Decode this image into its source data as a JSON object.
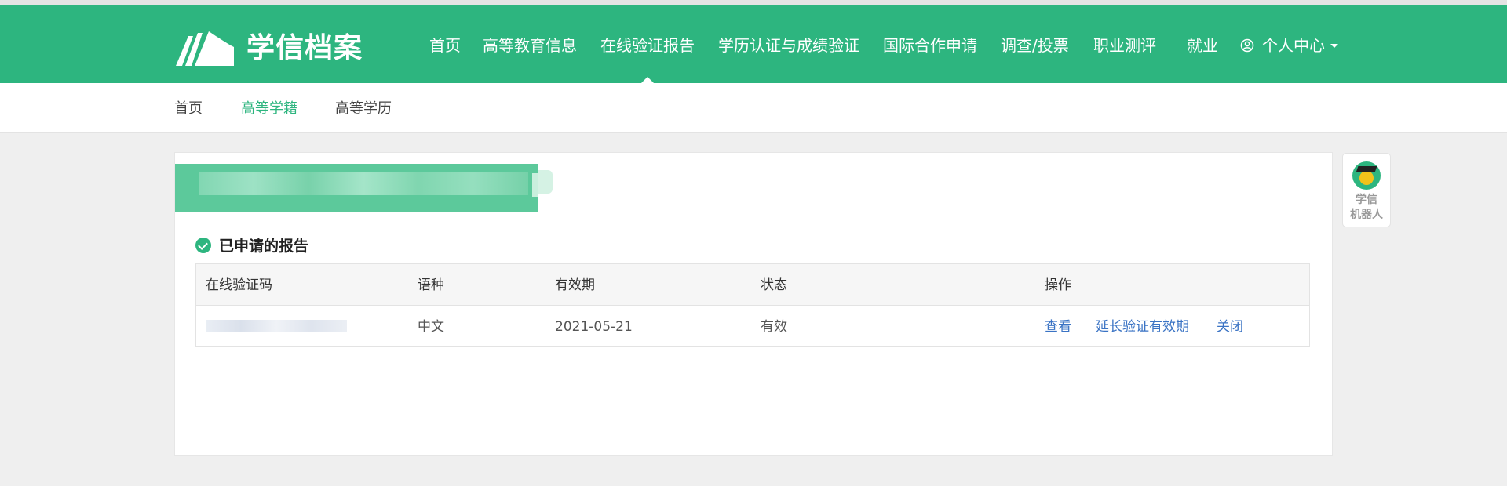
{
  "header": {
    "logo_text": "学信档案",
    "nav": [
      "首页",
      "高等教育信息",
      "在线验证报告",
      "学历认证与成绩验证",
      "国际合作申请",
      "调查/投票",
      "职业测评",
      "就业"
    ],
    "active_nav": "在线验证报告",
    "user_menu": "个人中心"
  },
  "subnav": {
    "items": [
      "首页",
      "高等学籍",
      "高等学历"
    ],
    "active": "高等学籍"
  },
  "main": {
    "section_title": "已申请的报告",
    "table": {
      "headers": [
        "在线验证码",
        "语种",
        "有效期",
        "状态",
        "操作"
      ],
      "rows": [
        {
          "language": "中文",
          "valid_until": "2021-05-21",
          "status": "有效",
          "actions": [
            "查看",
            "延长验证有效期",
            "关闭"
          ]
        }
      ]
    }
  },
  "robot": {
    "label_line1": "学信",
    "label_line2": "机器人"
  },
  "colors": {
    "brand_green": "#2db57f",
    "link_blue": "#3a73c4",
    "page_bg": "#efefef"
  }
}
